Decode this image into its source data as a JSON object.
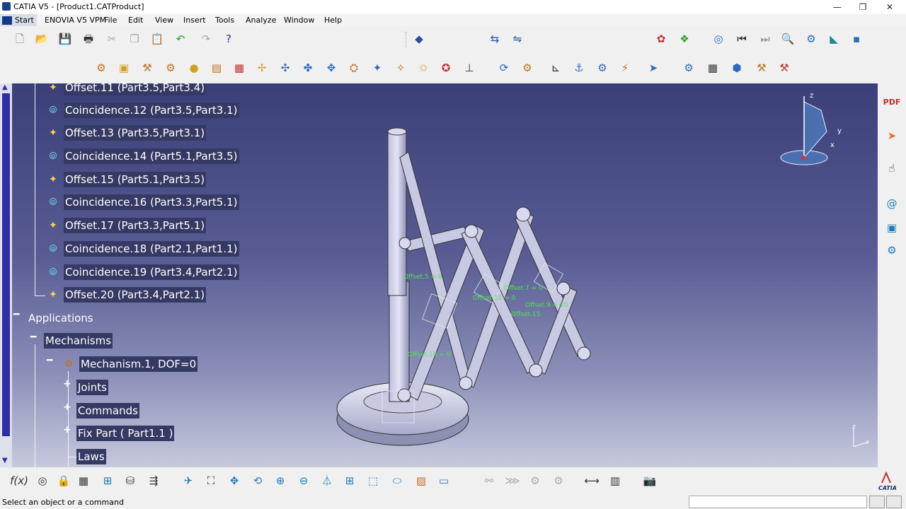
{
  "window": {
    "title": "CATIA V5 - [Product1.CATProduct]",
    "minimize": "—",
    "maximize": "❐",
    "close": "✕"
  },
  "menubar": {
    "items": [
      "Start",
      "ENOVIA V5 VPM",
      "File",
      "Edit",
      "View",
      "Insert",
      "Tools",
      "Analyze",
      "Window",
      "Help"
    ]
  },
  "tree": {
    "constraints": [
      {
        "label": "Offset.11 (Part3.5,Part3.4)",
        "icon": "offset-constraint-icon"
      },
      {
        "label": "Coincidence.12 (Part3.5,Part3.1)",
        "icon": "coincidence-constraint-icon"
      },
      {
        "label": "Offset.13 (Part3.5,Part3.1)",
        "icon": "offset-constraint-icon"
      },
      {
        "label": "Coincidence.14 (Part5.1,Part3.5)",
        "icon": "coincidence-constraint-icon"
      },
      {
        "label": "Offset.15 (Part5.1,Part3.5)",
        "icon": "offset-constraint-icon"
      },
      {
        "label": "Coincidence.16 (Part3.3,Part5.1)",
        "icon": "coincidence-constraint-icon"
      },
      {
        "label": "Offset.17 (Part3.3,Part5.1)",
        "icon": "offset-constraint-icon"
      },
      {
        "label": "Coincidence.18 (Part2.1,Part1.1)",
        "icon": "coincidence-constraint-icon"
      },
      {
        "label": "Coincidence.19 (Part3.4,Part2.1)",
        "icon": "coincidence-constraint-icon"
      },
      {
        "label": "Offset.20 (Part3.4,Part2.1)",
        "icon": "offset-constraint-icon"
      }
    ],
    "applications": "Applications",
    "mechanisms": "Mechanisms",
    "mechanism": "Mechanism.1, DOF=0",
    "joints": "Joints",
    "commands": "Commands",
    "fix_part": "Fix Part ( Part1.1 )",
    "laws": "Laws"
  },
  "viewport": {
    "annotations": [
      "Offset.5 = 0",
      "Offset.7 = 0",
      "Offset.9 = 20",
      "Offset.15",
      "Offset.10 = 0",
      "Offset.11 = 0"
    ],
    "compass": {
      "x": "x",
      "y": "y",
      "z": "z"
    },
    "axis_small": {
      "x": "x",
      "z": "z"
    }
  },
  "status": {
    "message": "Select an object or a command"
  },
  "brand": {
    "name": "CATIA"
  },
  "colors": {
    "viewport_top": "#3b3f78",
    "viewport_bottom": "#c7c9dd",
    "tree_label_bg": "#353a64",
    "constraint_green": "#4ee64e"
  }
}
